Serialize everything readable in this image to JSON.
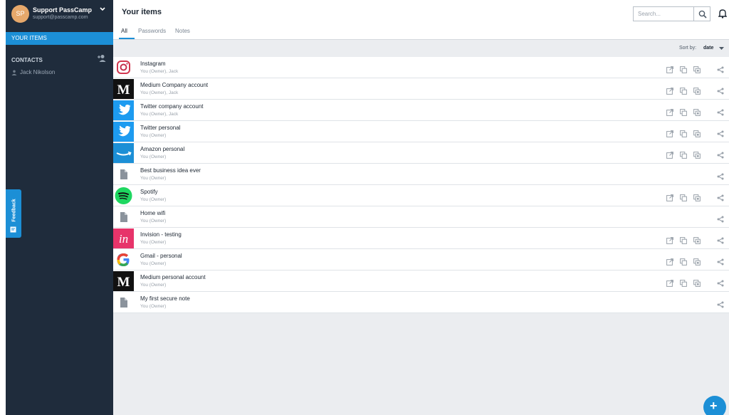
{
  "account": {
    "initials": "SP",
    "name": "Support PassCamp",
    "email": "support@passcamp.com"
  },
  "sidebar": {
    "your_items_label": "YOUR ITEMS",
    "contacts_label": "CONTACTS",
    "contacts": [
      "Jack Nikolson"
    ]
  },
  "feedback": {
    "label": "Feedback"
  },
  "header": {
    "title": "Your items",
    "tabs": [
      {
        "label": "All",
        "active": true
      },
      {
        "label": "Passwords",
        "active": false
      },
      {
        "label": "Notes",
        "active": false
      }
    ],
    "search_placeholder": "Search..."
  },
  "sort": {
    "label": "Sort by:",
    "value": "date"
  },
  "items": [
    {
      "title": "Instagram",
      "sub": "You (Owner), Jack",
      "icon": "instagram-icon",
      "actions": true
    },
    {
      "title": "Medium Company account",
      "sub": "You (Owner), Jack",
      "icon": "medium-icon",
      "actions": true
    },
    {
      "title": "Twitter company account",
      "sub": "You (Owner), Jack",
      "icon": "twitter-icon",
      "actions": true
    },
    {
      "title": "Twitter personal",
      "sub": "You (Owner)",
      "icon": "twitter-icon",
      "actions": true
    },
    {
      "title": "Amazon personal",
      "sub": "You (Owner)",
      "icon": "amazon-icon",
      "actions": true
    },
    {
      "title": "Best business idea ever",
      "sub": "You (Owner)",
      "icon": "note-icon",
      "actions": false
    },
    {
      "title": "Spotify",
      "sub": "You (Owner)",
      "icon": "spotify-icon",
      "actions": true
    },
    {
      "title": "Home wifi",
      "sub": "You (Owner)",
      "icon": "note-icon",
      "actions": false
    },
    {
      "title": "Invision - testing",
      "sub": "You (Owner)",
      "icon": "invision-icon",
      "actions": true
    },
    {
      "title": "Gmail - personal",
      "sub": "You (Owner)",
      "icon": "google-icon",
      "actions": true
    },
    {
      "title": "Medium personal account",
      "sub": "You (Owner)",
      "icon": "medium-icon",
      "actions": true
    },
    {
      "title": "My first secure note",
      "sub": "You (Owner)",
      "icon": "note-icon",
      "actions": false
    }
  ],
  "fab": {
    "label": "+"
  },
  "colors": {
    "accent": "#1c8fd6",
    "sidebar": "#1f2c3c"
  }
}
